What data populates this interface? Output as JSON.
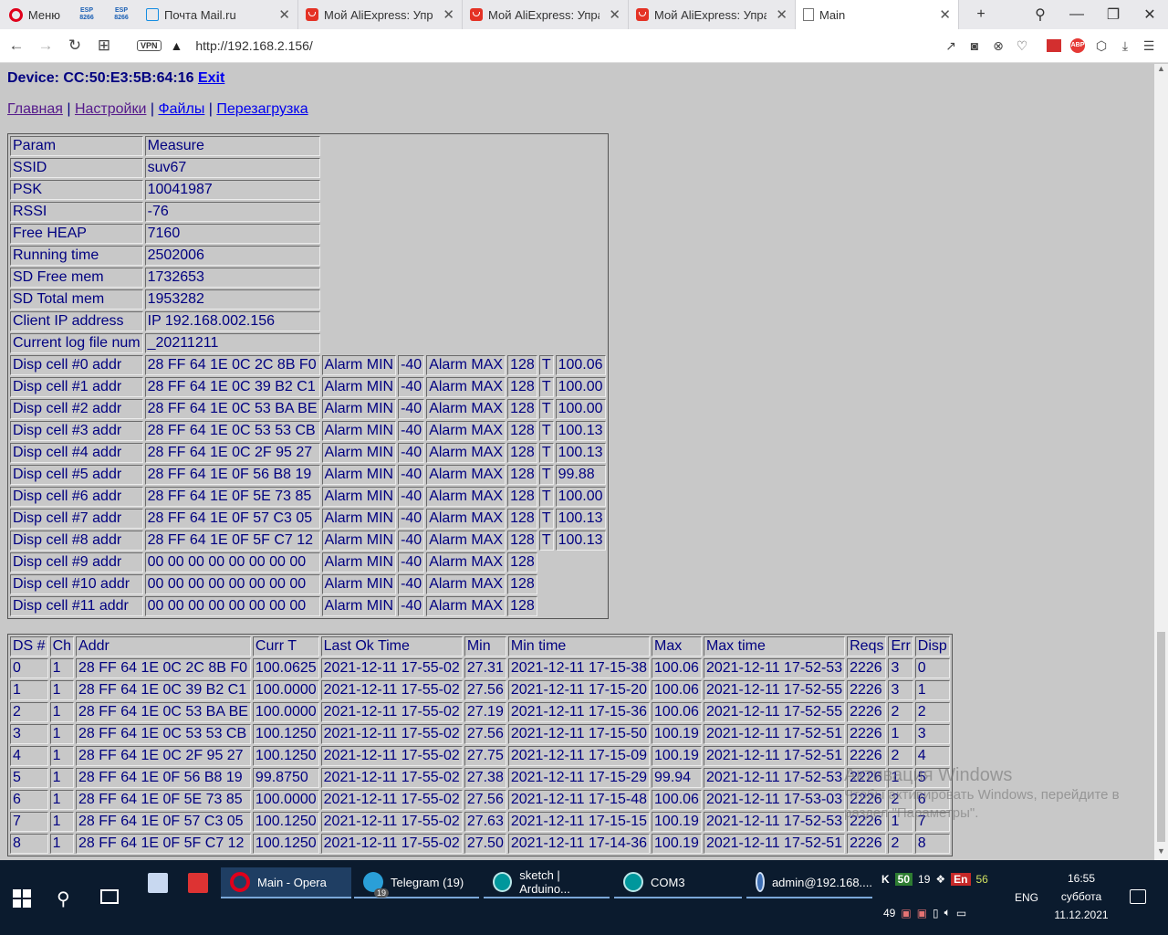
{
  "browser": {
    "menu_label": "Меню",
    "esp_label": "ESP 8266",
    "tabs": [
      {
        "title": "Почта Mail.ru",
        "icon": "mail-icon"
      },
      {
        "title": "Мой AliExpress: Управл",
        "icon": "aliexpress-icon"
      },
      {
        "title": "Мой AliExpress: Управл",
        "icon": "aliexpress-icon"
      },
      {
        "title": "Мой AliExpress: Управл",
        "icon": "aliexpress-icon"
      },
      {
        "title": "Main",
        "icon": "page-icon"
      }
    ],
    "vpn_label": "VPN",
    "url": "http://192.168.2.156/",
    "abp_label": "ABP"
  },
  "page": {
    "device_prefix": "Device: CC:50:E3:5B:64:16",
    "exit_label": "Exit",
    "nav_links": [
      "Главная",
      "Настройки",
      "Файлы",
      "Перезагрузка"
    ],
    "nav_separator": "|"
  },
  "params_table": {
    "header": [
      "Param",
      "Measure"
    ],
    "rows": [
      [
        "SSID",
        "suv67"
      ],
      [
        "PSK",
        "10041987"
      ],
      [
        "RSSI",
        "-76"
      ],
      [
        "Free HEAP",
        "7160"
      ],
      [
        "Running time",
        "2502006"
      ],
      [
        "SD Free mem",
        "1732653"
      ],
      [
        "SD Total mem",
        "1953282"
      ],
      [
        "Client IP address",
        "IP 192.168.002.156"
      ],
      [
        "Current log file num",
        "_20211211"
      ]
    ],
    "disp_rows": [
      [
        "Disp cell #0 addr",
        "28 FF 64 1E 0C 2C 8B F0",
        "Alarm MIN",
        "-40",
        "Alarm MAX",
        "128",
        "T",
        "100.06"
      ],
      [
        "Disp cell #1 addr",
        "28 FF 64 1E 0C 39 B2 C1",
        "Alarm MIN",
        "-40",
        "Alarm MAX",
        "128",
        "T",
        "100.00"
      ],
      [
        "Disp cell #2 addr",
        "28 FF 64 1E 0C 53 BA BE",
        "Alarm MIN",
        "-40",
        "Alarm MAX",
        "128",
        "T",
        "100.00"
      ],
      [
        "Disp cell #3 addr",
        "28 FF 64 1E 0C 53 53 CB",
        "Alarm MIN",
        "-40",
        "Alarm MAX",
        "128",
        "T",
        "100.13"
      ],
      [
        "Disp cell #4 addr",
        "28 FF 64 1E 0C 2F 95 27",
        "Alarm MIN",
        "-40",
        "Alarm MAX",
        "128",
        "T",
        "100.13"
      ],
      [
        "Disp cell #5 addr",
        "28 FF 64 1E 0F 56 B8 19",
        "Alarm MIN",
        "-40",
        "Alarm MAX",
        "128",
        "T",
        "99.88"
      ],
      [
        "Disp cell #6 addr",
        "28 FF 64 1E 0F 5E 73 85",
        "Alarm MIN",
        "-40",
        "Alarm MAX",
        "128",
        "T",
        "100.00"
      ],
      [
        "Disp cell #7 addr",
        "28 FF 64 1E 0F 57 C3 05",
        "Alarm MIN",
        "-40",
        "Alarm MAX",
        "128",
        "T",
        "100.13"
      ],
      [
        "Disp cell #8 addr",
        "28 FF 64 1E 0F 5F C7 12",
        "Alarm MIN",
        "-40",
        "Alarm MAX",
        "128",
        "T",
        "100.13"
      ],
      [
        "Disp cell #9 addr",
        "00 00 00 00 00 00 00 00",
        "Alarm MIN",
        "-40",
        "Alarm MAX",
        "128"
      ],
      [
        "Disp cell #10 addr",
        "00 00 00 00 00 00 00 00",
        "Alarm MIN",
        "-40",
        "Alarm MAX",
        "128"
      ],
      [
        "Disp cell #11 addr",
        "00 00 00 00 00 00 00 00",
        "Alarm MIN",
        "-40",
        "Alarm MAX",
        "128"
      ]
    ]
  },
  "ds_table": {
    "header": [
      "DS #",
      "Ch",
      "Addr",
      "Curr T",
      "Last Ok Time",
      "Min",
      "Min time",
      "Max",
      "Max time",
      "Reqs",
      "Err",
      "Disp"
    ],
    "rows": [
      [
        "0",
        "1",
        "28 FF 64 1E 0C 2C 8B F0",
        "100.0625",
        "2021-12-11 17-55-02",
        "27.31",
        "2021-12-11 17-15-38",
        "100.06",
        "2021-12-11 17-52-53",
        "2226",
        "3",
        "0"
      ],
      [
        "1",
        "1",
        "28 FF 64 1E 0C 39 B2 C1",
        "100.0000",
        "2021-12-11 17-55-02",
        "27.56",
        "2021-12-11 17-15-20",
        "100.06",
        "2021-12-11 17-52-55",
        "2226",
        "3",
        "1"
      ],
      [
        "2",
        "1",
        "28 FF 64 1E 0C 53 BA BE",
        "100.0000",
        "2021-12-11 17-55-02",
        "27.19",
        "2021-12-11 17-15-36",
        "100.06",
        "2021-12-11 17-52-55",
        "2226",
        "2",
        "2"
      ],
      [
        "3",
        "1",
        "28 FF 64 1E 0C 53 53 CB",
        "100.1250",
        "2021-12-11 17-55-02",
        "27.56",
        "2021-12-11 17-15-50",
        "100.19",
        "2021-12-11 17-52-51",
        "2226",
        "1",
        "3"
      ],
      [
        "4",
        "1",
        "28 FF 64 1E 0C 2F 95 27",
        "100.1250",
        "2021-12-11 17-55-02",
        "27.75",
        "2021-12-11 17-15-09",
        "100.19",
        "2021-12-11 17-52-51",
        "2226",
        "2",
        "4"
      ],
      [
        "5",
        "1",
        "28 FF 64 1E 0F 56 B8 19",
        "99.8750",
        "2021-12-11 17-55-02",
        "27.38",
        "2021-12-11 17-15-29",
        "99.94",
        "2021-12-11 17-52-53",
        "2226",
        "1",
        "5"
      ],
      [
        "6",
        "1",
        "28 FF 64 1E 0F 5E 73 85",
        "100.0000",
        "2021-12-11 17-55-02",
        "27.56",
        "2021-12-11 17-15-48",
        "100.06",
        "2021-12-11 17-53-03",
        "2226",
        "2",
        "6"
      ],
      [
        "7",
        "1",
        "28 FF 64 1E 0F 57 C3 05",
        "100.1250",
        "2021-12-11 17-55-02",
        "27.63",
        "2021-12-11 17-15-15",
        "100.19",
        "2021-12-11 17-52-53",
        "2226",
        "1",
        "7"
      ],
      [
        "8",
        "1",
        "28 FF 64 1E 0F 5F C7 12",
        "100.1250",
        "2021-12-11 17-55-02",
        "27.50",
        "2021-12-11 17-14-36",
        "100.19",
        "2021-12-11 17-52-51",
        "2226",
        "2",
        "8"
      ]
    ]
  },
  "watermark": {
    "line1": "Активация Windows",
    "line2": "Чтобы активировать Windows, перейдите в",
    "line3": "раздел \"Параметры\"."
  },
  "taskbar": {
    "apps": [
      {
        "label": "Main - Opera",
        "icon": "opera-icon",
        "active": true
      },
      {
        "label": "Telegram (19)",
        "icon": "telegram-icon",
        "badge": "19"
      },
      {
        "label": "sketch | Arduino...",
        "icon": "arduino-icon"
      },
      {
        "label": "COM3",
        "icon": "arduino-icon"
      },
      {
        "label": "admin@192.168....",
        "icon": "putty-icon"
      }
    ],
    "tray_top": [
      "50",
      "19",
      "En",
      "56"
    ],
    "tray_bottom": [
      "49"
    ],
    "lang": "ENG",
    "time": "16:55",
    "day": "суббота",
    "date": "11.12.2021"
  },
  "colors": {
    "page_bg": "#c8c8c8",
    "text": "#000080",
    "link": "#0000ee",
    "visited_link": "#551a8b",
    "taskbar": "#0b1b2e"
  }
}
